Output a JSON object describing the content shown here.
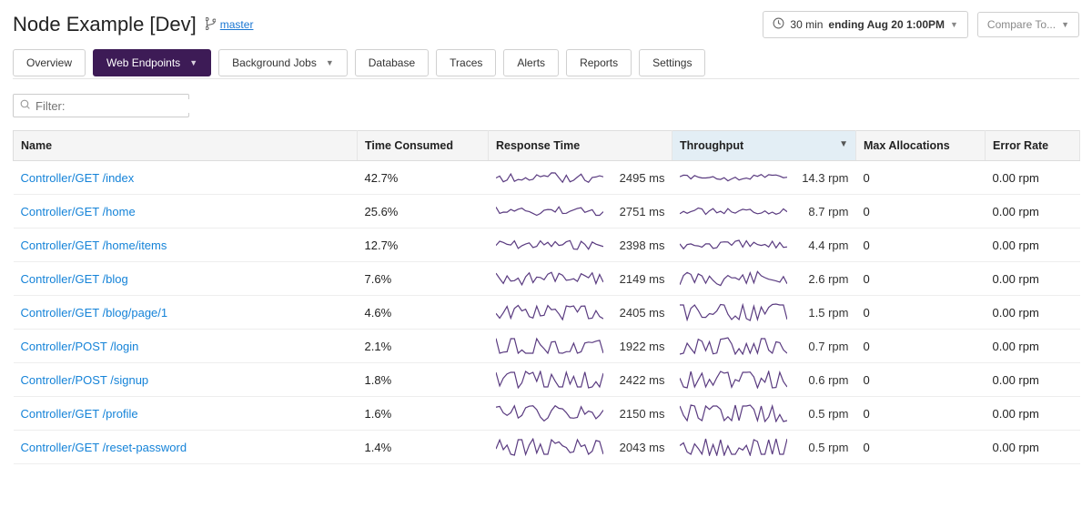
{
  "header": {
    "title": "Node Example [Dev]",
    "branch": "master",
    "time_picker": {
      "prefix": "30 min ",
      "bold": "ending Aug 20 1:00PM"
    },
    "compare_label": "Compare To..."
  },
  "nav": {
    "overview": "Overview",
    "web_endpoints": "Web Endpoints",
    "background_jobs": "Background Jobs",
    "database": "Database",
    "traces": "Traces",
    "alerts": "Alerts",
    "reports": "Reports",
    "settings": "Settings"
  },
  "filter": {
    "placeholder": "Filter:"
  },
  "columns": {
    "name": "Name",
    "time_consumed": "Time Consumed",
    "response_time": "Response Time",
    "throughput": "Throughput",
    "max_alloc": "Max Allocations",
    "error_rate": "Error Rate",
    "sort_indicator": "▼"
  },
  "rows": [
    {
      "name": "Controller/GET /index",
      "time": "42.7%",
      "resp": "2495 ms",
      "thr": "14.3 rpm",
      "alloc": "0",
      "err": "0.00 rpm",
      "rps": 2,
      "tps": 1
    },
    {
      "name": "Controller/GET /home",
      "time": "25.6%",
      "resp": "2751 ms",
      "thr": "8.7 rpm",
      "alloc": "0",
      "err": "0.00 rpm",
      "rps": 2,
      "tps": 1
    },
    {
      "name": "Controller/GET /home/items",
      "time": "12.7%",
      "resp": "2398 ms",
      "thr": "4.4 rpm",
      "alloc": "0",
      "err": "0.00 rpm",
      "rps": 2,
      "tps": 2
    },
    {
      "name": "Controller/GET /blog",
      "time": "7.6%",
      "resp": "2149 ms",
      "thr": "2.6 rpm",
      "alloc": "0",
      "err": "0.00 rpm",
      "rps": 3,
      "tps": 4
    },
    {
      "name": "Controller/GET /blog/page/1",
      "time": "4.6%",
      "resp": "2405 ms",
      "thr": "1.5 rpm",
      "alloc": "0",
      "err": "0.00 rpm",
      "rps": 4,
      "tps": 5
    },
    {
      "name": "Controller/POST /login",
      "time": "2.1%",
      "resp": "1922 ms",
      "thr": "0.7 rpm",
      "alloc": "0",
      "err": "0.00 rpm",
      "rps": 5,
      "tps": 6
    },
    {
      "name": "Controller/POST /signup",
      "time": "1.8%",
      "resp": "2422 ms",
      "thr": "0.6 rpm",
      "alloc": "0",
      "err": "0.00 rpm",
      "rps": 6,
      "tps": 6
    },
    {
      "name": "Controller/GET /profile",
      "time": "1.6%",
      "resp": "2150 ms",
      "thr": "0.5 rpm",
      "alloc": "0",
      "err": "0.00 rpm",
      "rps": 4,
      "tps": 7
    },
    {
      "name": "Controller/GET /reset-password",
      "time": "1.4%",
      "resp": "2043 ms",
      "thr": "0.5 rpm",
      "alloc": "0",
      "err": "0.00 rpm",
      "rps": 5,
      "tps": 7
    }
  ]
}
